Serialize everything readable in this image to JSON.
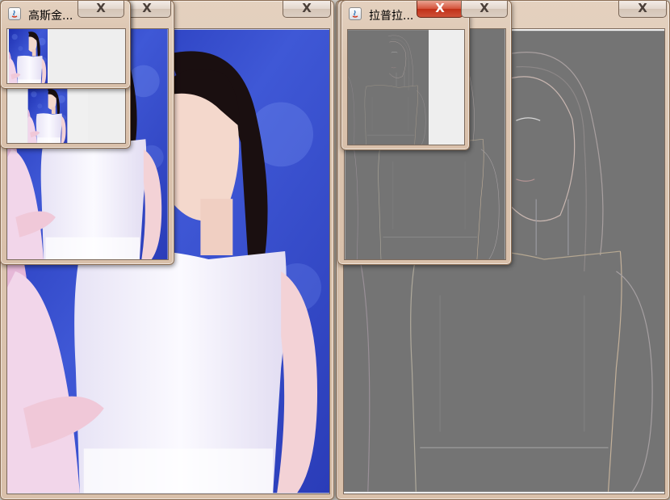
{
  "windows": {
    "main_left": {
      "close_glyph": "X"
    },
    "main_right": {
      "close_glyph": "X"
    },
    "gauss_front": {
      "title": "高斯金...",
      "close_glyph": "X"
    },
    "gauss_back": {
      "close_glyph": "X"
    },
    "laplace": {
      "title": "拉普拉...",
      "close_glyph": "X"
    }
  },
  "colors": {
    "frame": "#dcc5b0",
    "close_active": "#c7402a",
    "edge_background": "#747474"
  },
  "icons": {
    "app": "java-icon",
    "close": "close-icon"
  }
}
